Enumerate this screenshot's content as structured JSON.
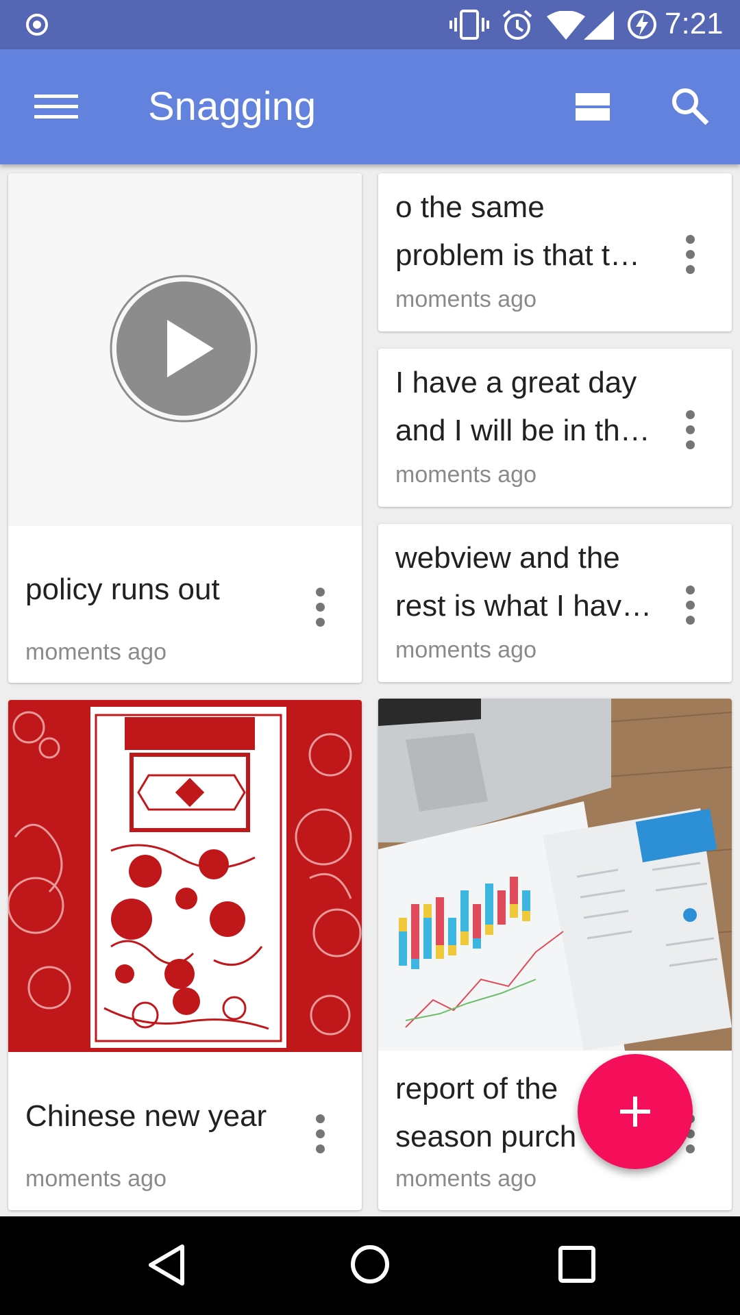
{
  "status_bar": {
    "time": "7:21",
    "icons": [
      "record-icon",
      "vibrate-icon",
      "alarm-icon",
      "wifi-icon",
      "signal-icon",
      "battery-charging-icon"
    ]
  },
  "app_bar": {
    "title": "Snagging",
    "icons": [
      "menu-icon",
      "view-toggle-icon",
      "search-icon"
    ]
  },
  "cards": {
    "video_note": {
      "title": "policy runs out",
      "time": "moments ago",
      "media_icon": "play-icon"
    },
    "note_1": {
      "line1": "o the same",
      "line2": "problem is that t…",
      "time": "moments ago"
    },
    "note_2": {
      "line1": "I have a great day",
      "line2": "and I will be in th…",
      "time": "moments ago"
    },
    "note_3": {
      "line1": "webview and the",
      "line2": "rest is what I hav…",
      "time": "moments ago"
    },
    "image_note_1": {
      "title": "Chinese new year",
      "time": "moments ago",
      "image_desc": "red paper-cut illustration"
    },
    "image_note_2": {
      "line1": "report of the",
      "line2": "season purch",
      "time": "moments ago",
      "image_desc": "laptop and printed charts"
    }
  },
  "fab": {
    "icon": "plus-icon"
  },
  "nav_bar": {
    "icons": [
      "back-icon",
      "home-icon",
      "recents-icon"
    ]
  },
  "colors": {
    "status_bar": "#5466b4",
    "app_bar": "#6282dd",
    "fab": "#f50f5a",
    "background": "#eeeeee"
  }
}
